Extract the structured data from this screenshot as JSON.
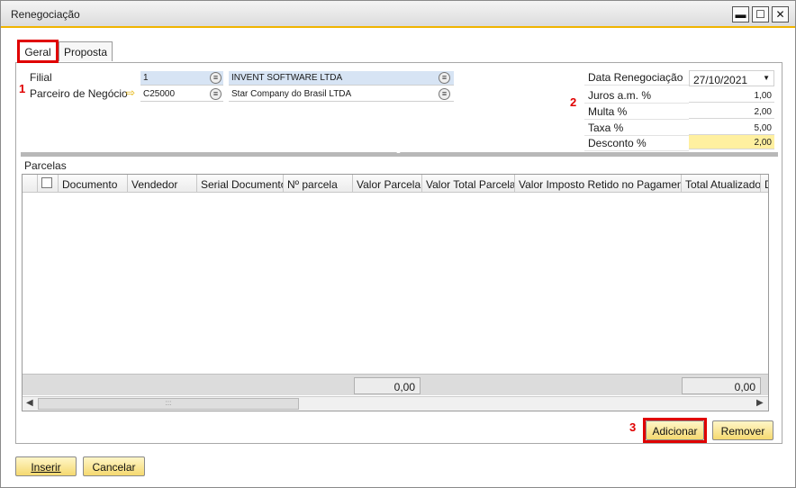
{
  "window": {
    "title": "Renegociação",
    "controls": {
      "minimize": "▬",
      "maximize": "☐",
      "close": "✕"
    }
  },
  "tabs": [
    {
      "label": "Geral",
      "active": true
    },
    {
      "label": "Proposta",
      "active": false
    }
  ],
  "annotations": {
    "one": "1",
    "two": "2",
    "three": "3"
  },
  "left_form": {
    "filial_label": "Filial",
    "filial_code": "1",
    "filial_name": "INVENT SOFTWARE LTDA",
    "parceiro_label": "Parceiro de Negócio",
    "parceiro_code": "C25000",
    "parceiro_name": "Star Company do Brasil LTDA"
  },
  "right_form": {
    "data_label": "Data Renegociação",
    "data_value": "27/10/2021",
    "juros_label": "Juros  a.m. %",
    "juros_value": "1,00",
    "multa_label": "Multa %",
    "multa_value": "2,00",
    "taxa_label": "Taxa %",
    "taxa_value": "5,00",
    "desconto_label": "Desconto %",
    "desconto_value": "2,00"
  },
  "parcelas": {
    "section_label": "Parcelas",
    "columns": [
      "Documento",
      "Vendedor",
      "Serial Documento",
      "Nº parcela",
      "Valor Parcela",
      "Valor Total Parcela",
      "Valor Imposto Retido no Pagamento",
      "Total Atualizado",
      "D"
    ],
    "total_valor_parcela": "0,00",
    "total_atualizado": "0,00",
    "scroll_grip": ":::"
  },
  "buttons": {
    "adicionar": "Adicionar",
    "remover": "Remover",
    "inserir": "Inserir",
    "cancelar": "Cancelar"
  },
  "colors": {
    "accent": "#f0b400",
    "highlight_red": "#e00000",
    "button": "#f5d970"
  }
}
